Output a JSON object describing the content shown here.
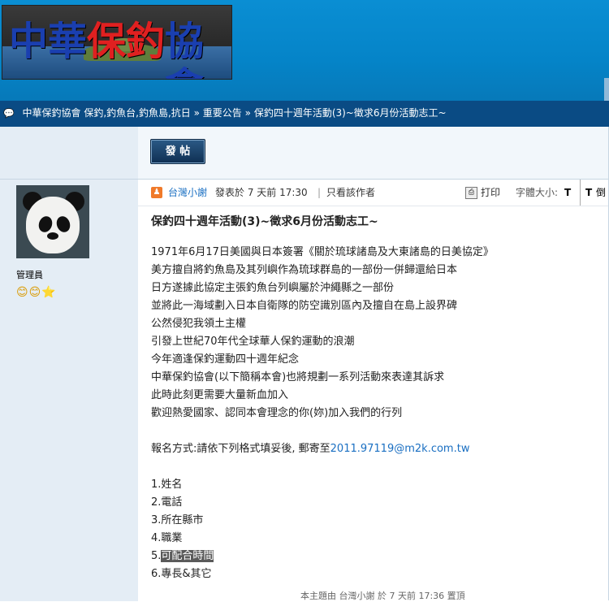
{
  "header": {
    "logo_text": [
      "中華",
      "保釣",
      "協會"
    ]
  },
  "breadcrumb": {
    "items": [
      "中華保釣協會 保釣,釣魚台,釣魚島,抗日",
      "»",
      "重要公告",
      "»",
      "保釣四十週年活動(3)~徵求6月份活動志工~"
    ]
  },
  "toolbar": {
    "post_label": "發 帖"
  },
  "author": {
    "role": "管理員",
    "badges": "😊😊⭐"
  },
  "meta": {
    "user_icon": "user-icon",
    "author": "台灣小謝",
    "posted": "發表於 7 天前 17:30",
    "separator": "|",
    "only_author": "只看該作者",
    "print": "打印",
    "font_size_label": "字體大小:",
    "fs_t1": "T",
    "fs_t2": "T",
    "fs_t3": "倒"
  },
  "post": {
    "title": "保釣四十週年活動(3)~徵求6月份活動志工~",
    "lines": [
      "1971年6月17日美國與日本簽署《關於琉球諸島及大東諸島的日美協定》",
      "美方擅自將釣魚島及其列嶼作為琉球群島的一部份一併歸還給日本",
      "日方遂據此協定主張釣魚台列嶼屬於沖繩縣之一部份",
      "並將此一海域劃入日本自衛隊的防空識別區內及擅自在島上設界碑",
      "公然侵犯我領土主權",
      "引發上世紀70年代全球華人保釣運動的浪潮",
      "今年適逢保釣運動四十週年紀念",
      "中華保釣協會(以下簡稱本會)也將規劃一系列活動來表達其訴求",
      "此時此刻更需要大量新血加入",
      "歡迎熱愛國家、認同本會理念的你(妳)加入我們的行列"
    ],
    "signup_prefix": "報名方式:請依下列格式填妥後, 郵寄至",
    "signup_email": "2011.97119@m2k.com.tw",
    "list": [
      "1.姓名",
      "2.電話",
      "3.所在縣市",
      "4.職業"
    ],
    "item5_prefix": "5.",
    "item5_text": "可配合時間",
    "item6": "6.專長&其它"
  },
  "footer": {
    "note": "本主題由 台灣小謝 於 7 天前 17:36 置頂"
  }
}
